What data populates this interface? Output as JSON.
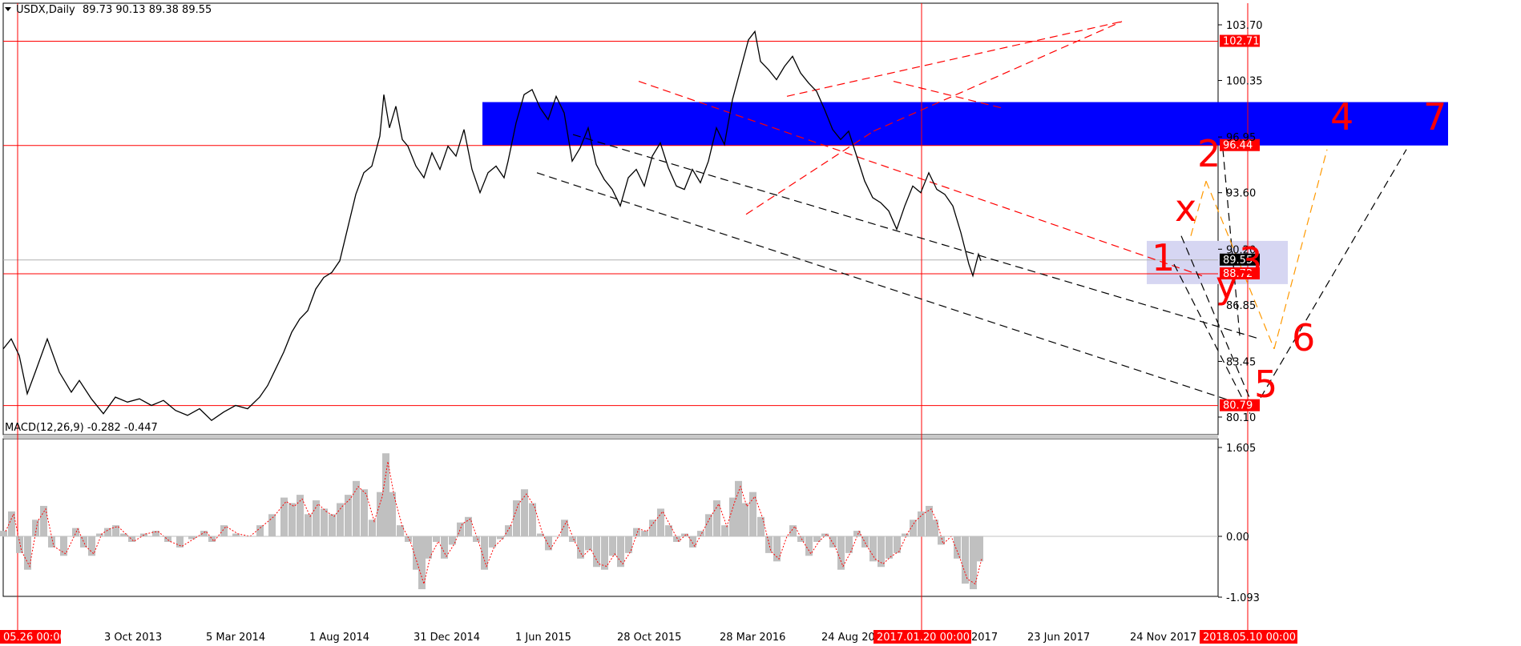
{
  "chart_data": [
    {
      "type": "line",
      "title": "USDX,Daily",
      "ohlc": "89.73 90.13 89.38 89.55",
      "ylim": [
        78.5,
        105.8
      ],
      "y_ticks": [
        "103.70",
        "100.35",
        "96.95",
        "93.60",
        "90.20",
        "86.85",
        "83.45",
        "80.10"
      ],
      "x_tick_labels": [
        "3 Oct 2013",
        "5 Mar 2014",
        "1 Aug 2014",
        "31 Dec 2014",
        "1 Jun 2015",
        "28 Oct 2015",
        "28 Mar 2016",
        "24 Aug 2016",
        "23 Jun 2017",
        "24 Nov 2017"
      ],
      "x_tick_partial": "2017",
      "x_marker_labels": {
        "left": "05.26 00:00",
        "mid": "2017.01.20 00:00",
        "right": "2018.05.10 00:00"
      },
      "price_markers": [
        {
          "label": "102.71",
          "value": 102.71
        },
        {
          "label": "96.44",
          "value": 96.44
        },
        {
          "label": "88.72",
          "value": 88.72
        },
        {
          "label": "80.79",
          "value": 80.79
        }
      ],
      "current_price": {
        "label": "89.55",
        "value": 89.55
      },
      "grid": false,
      "series": [
        {
          "name": "",
          "values": [
            [
              0,
              84.2
            ],
            [
              10,
              84.8
            ],
            [
              20,
              83.8
            ],
            [
              30,
              81.5
            ],
            [
              40,
              82.8
            ],
            [
              55,
              84.8
            ],
            [
              70,
              82.8
            ],
            [
              85,
              81.6
            ],
            [
              95,
              82.3
            ],
            [
              110,
              81.2
            ],
            [
              125,
              80.3
            ],
            [
              140,
              81.3
            ],
            [
              155,
              81.0
            ],
            [
              170,
              81.2
            ],
            [
              185,
              80.8
            ],
            [
              200,
              81.1
            ],
            [
              215,
              80.5
            ],
            [
              230,
              80.2
            ],
            [
              245,
              80.6
            ],
            [
              260,
              79.9
            ],
            [
              275,
              80.4
            ],
            [
              290,
              80.8
            ],
            [
              305,
              80.6
            ],
            [
              320,
              81.3
            ],
            [
              330,
              82.0
            ],
            [
              340,
              83.0
            ],
            [
              350,
              84.0
            ],
            [
              360,
              85.2
            ],
            [
              370,
              86.0
            ],
            [
              380,
              86.5
            ],
            [
              390,
              87.8
            ],
            [
              400,
              88.5
            ],
            [
              410,
              88.8
            ],
            [
              420,
              89.5
            ],
            [
              430,
              91.5
            ],
            [
              440,
              93.5
            ],
            [
              450,
              94.8
            ],
            [
              460,
              95.2
            ],
            [
              470,
              97.0
            ],
            [
              475,
              99.5
            ],
            [
              482,
              97.5
            ],
            [
              490,
              98.8
            ],
            [
              498,
              96.8
            ],
            [
              505,
              96.4
            ],
            [
              515,
              95.2
            ],
            [
              525,
              94.5
            ],
            [
              535,
              96.0
            ],
            [
              545,
              95.0
            ],
            [
              555,
              96.4
            ],
            [
              565,
              95.8
            ],
            [
              575,
              97.4
            ],
            [
              585,
              95.0
            ],
            [
              595,
              93.6
            ],
            [
              605,
              94.8
            ],
            [
              615,
              95.2
            ],
            [
              625,
              94.5
            ],
            [
              630,
              95.5
            ],
            [
              640,
              97.8
            ],
            [
              650,
              99.5
            ],
            [
              660,
              99.8
            ],
            [
              670,
              98.7
            ],
            [
              680,
              98.0
            ],
            [
              690,
              99.4
            ],
            [
              700,
              98.4
            ],
            [
              710,
              95.5
            ],
            [
              720,
              96.3
            ],
            [
              730,
              97.5
            ],
            [
              740,
              95.3
            ],
            [
              750,
              94.4
            ],
            [
              760,
              93.8
            ],
            [
              770,
              92.8
            ],
            [
              780,
              94.5
            ],
            [
              790,
              95.0
            ],
            [
              800,
              94.0
            ],
            [
              810,
              95.8
            ],
            [
              820,
              96.6
            ],
            [
              830,
              95.1
            ],
            [
              840,
              94.0
            ],
            [
              850,
              93.8
            ],
            [
              860,
              95.0
            ],
            [
              870,
              94.2
            ],
            [
              880,
              95.5
            ],
            [
              890,
              97.5
            ],
            [
              900,
              96.5
            ],
            [
              910,
              99.2
            ],
            [
              920,
              101.0
            ],
            [
              930,
              102.8
            ],
            [
              938,
              103.3
            ],
            [
              945,
              101.5
            ],
            [
              955,
              101.0
            ],
            [
              965,
              100.4
            ],
            [
              975,
              101.2
            ],
            [
              985,
              101.8
            ],
            [
              995,
              100.8
            ],
            [
              1005,
              100.2
            ],
            [
              1015,
              99.7
            ],
            [
              1025,
              98.6
            ],
            [
              1035,
              97.4
            ],
            [
              1045,
              96.8
            ],
            [
              1055,
              97.3
            ],
            [
              1065,
              95.8
            ],
            [
              1075,
              94.3
            ],
            [
              1085,
              93.3
            ],
            [
              1095,
              93.0
            ],
            [
              1105,
              92.5
            ],
            [
              1115,
              91.4
            ],
            [
              1125,
              92.8
            ],
            [
              1135,
              94.0
            ],
            [
              1145,
              93.6
            ],
            [
              1155,
              94.8
            ],
            [
              1165,
              93.8
            ],
            [
              1175,
              93.5
            ],
            [
              1185,
              92.8
            ],
            [
              1195,
              91.2
            ],
            [
              1205,
              89.3
            ],
            [
              1210,
              88.6
            ],
            [
              1217,
              89.9
            ],
            [
              1220,
              89.5
            ]
          ]
        }
      ],
      "annotations": [
        "1",
        "2",
        "3",
        "4",
        "5",
        "6",
        "7",
        "x",
        "y"
      ]
    },
    {
      "type": "area",
      "title": "MACD(12,26,9) -0.282 -0.447",
      "ylim": [
        -1.093,
        1.605
      ],
      "y_ticks": [
        "1.605",
        "0.00",
        "-1.093"
      ],
      "series": [
        {
          "name": "",
          "values": [
            [
              0,
              0.1
            ],
            [
              10,
              0.45
            ],
            [
              20,
              -0.3
            ],
            [
              30,
              -0.6
            ],
            [
              40,
              0.3
            ],
            [
              50,
              0.55
            ],
            [
              60,
              -0.2
            ],
            [
              75,
              -0.35
            ],
            [
              90,
              0.15
            ],
            [
              100,
              -0.2
            ],
            [
              110,
              -0.35
            ],
            [
              120,
              0.05
            ],
            [
              130,
              0.15
            ],
            [
              140,
              0.2
            ],
            [
              150,
              0.05
            ],
            [
              160,
              -0.1
            ],
            [
              175,
              0.05
            ],
            [
              190,
              0.1
            ],
            [
              205,
              -0.1
            ],
            [
              220,
              -0.2
            ],
            [
              235,
              -0.05
            ],
            [
              250,
              0.1
            ],
            [
              260,
              -0.1
            ],
            [
              275,
              0.2
            ],
            [
              290,
              0.05
            ],
            [
              305,
              0.0
            ],
            [
              320,
              0.2
            ],
            [
              335,
              0.4
            ],
            [
              350,
              0.7
            ],
            [
              360,
              0.6
            ],
            [
              370,
              0.75
            ],
            [
              380,
              0.4
            ],
            [
              390,
              0.65
            ],
            [
              400,
              0.5
            ],
            [
              410,
              0.4
            ],
            [
              420,
              0.6
            ],
            [
              430,
              0.75
            ],
            [
              440,
              1.0
            ],
            [
              450,
              0.85
            ],
            [
              460,
              0.3
            ],
            [
              470,
              0.8
            ],
            [
              477,
              1.5
            ],
            [
              485,
              0.8
            ],
            [
              495,
              0.2
            ],
            [
              505,
              -0.1
            ],
            [
              515,
              -0.6
            ],
            [
              522,
              -0.95
            ],
            [
              530,
              -0.4
            ],
            [
              540,
              -0.1
            ],
            [
              550,
              -0.4
            ],
            [
              560,
              -0.15
            ],
            [
              570,
              0.25
            ],
            [
              580,
              0.35
            ],
            [
              590,
              -0.1
            ],
            [
              600,
              -0.6
            ],
            [
              610,
              -0.2
            ],
            [
              620,
              -0.05
            ],
            [
              630,
              0.2
            ],
            [
              640,
              0.65
            ],
            [
              650,
              0.85
            ],
            [
              660,
              0.6
            ],
            [
              670,
              0.05
            ],
            [
              680,
              -0.25
            ],
            [
              690,
              0.0
            ],
            [
              700,
              0.3
            ],
            [
              710,
              -0.1
            ],
            [
              720,
              -0.4
            ],
            [
              730,
              -0.25
            ],
            [
              740,
              -0.55
            ],
            [
              750,
              -0.6
            ],
            [
              760,
              -0.35
            ],
            [
              770,
              -0.55
            ],
            [
              780,
              -0.3
            ],
            [
              790,
              0.15
            ],
            [
              800,
              0.1
            ],
            [
              810,
              0.3
            ],
            [
              820,
              0.5
            ],
            [
              830,
              0.2
            ],
            [
              840,
              -0.1
            ],
            [
              850,
              0.05
            ],
            [
              860,
              -0.2
            ],
            [
              870,
              0.1
            ],
            [
              880,
              0.4
            ],
            [
              890,
              0.65
            ],
            [
              900,
              0.2
            ],
            [
              910,
              0.7
            ],
            [
              917,
              1.0
            ],
            [
              925,
              0.6
            ],
            [
              935,
              0.8
            ],
            [
              945,
              0.35
            ],
            [
              955,
              -0.3
            ],
            [
              965,
              -0.45
            ],
            [
              975,
              0.0
            ],
            [
              985,
              0.2
            ],
            [
              995,
              -0.1
            ],
            [
              1005,
              -0.35
            ],
            [
              1015,
              -0.1
            ],
            [
              1025,
              0.05
            ],
            [
              1035,
              -0.2
            ],
            [
              1045,
              -0.6
            ],
            [
              1055,
              -0.3
            ],
            [
              1065,
              0.1
            ],
            [
              1075,
              -0.2
            ],
            [
              1085,
              -0.45
            ],
            [
              1095,
              -0.55
            ],
            [
              1105,
              -0.4
            ],
            [
              1115,
              -0.3
            ],
            [
              1125,
              0.05
            ],
            [
              1135,
              0.3
            ],
            [
              1145,
              0.45
            ],
            [
              1155,
              0.55
            ],
            [
              1162,
              0.3
            ],
            [
              1170,
              -0.15
            ],
            [
              1180,
              0.0
            ],
            [
              1190,
              -0.4
            ],
            [
              1200,
              -0.85
            ],
            [
              1210,
              -0.95
            ],
            [
              1218,
              -0.45
            ]
          ]
        }
      ]
    }
  ]
}
